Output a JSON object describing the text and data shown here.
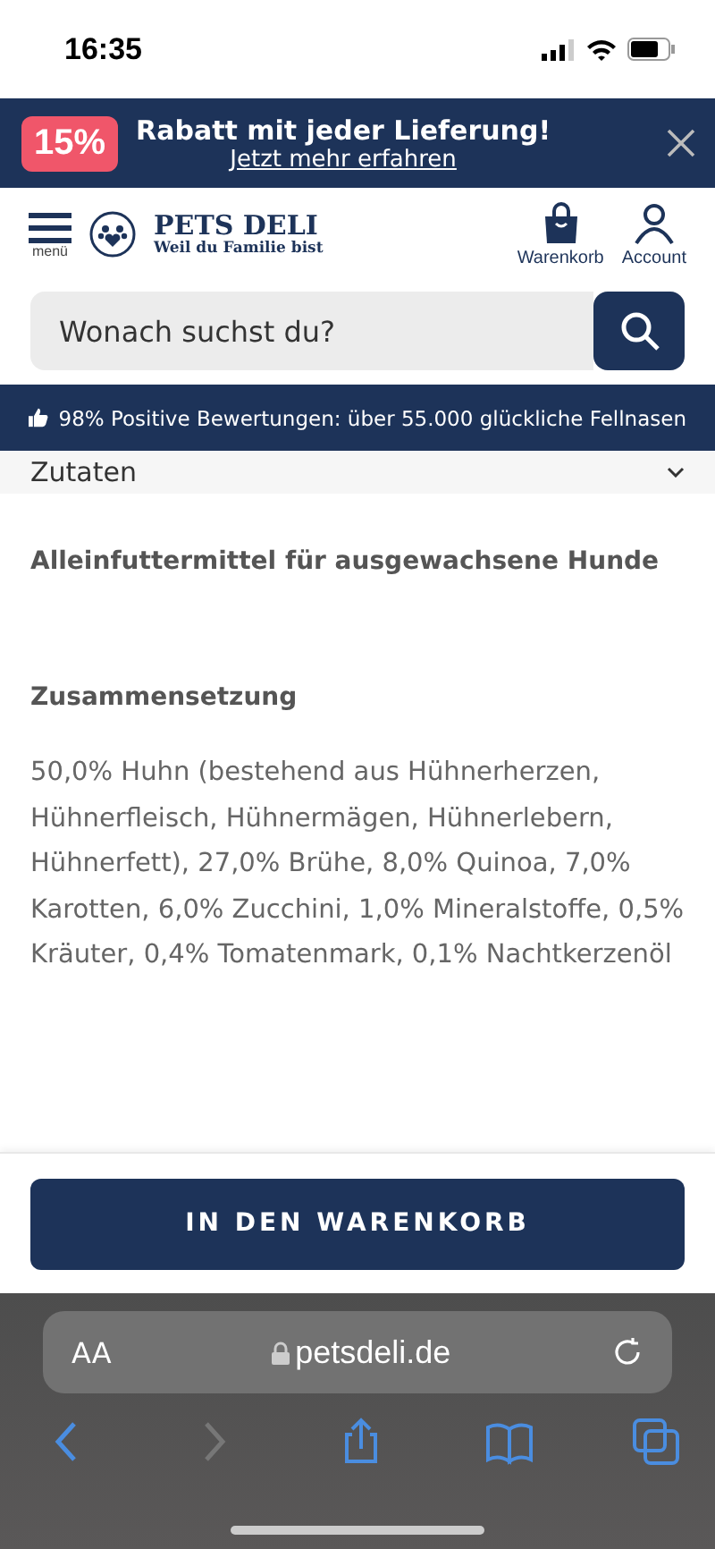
{
  "status_bar": {
    "time": "16:35"
  },
  "promo": {
    "badge": "15%",
    "title": "Rabatt mit jeder Lieferung!",
    "link": "Jetzt mehr erfahren"
  },
  "header": {
    "menu_label": "menü",
    "brand": "PETS DELI",
    "tagline": "Weil du Familie bist",
    "actions": [
      {
        "kind": "cart",
        "label": "Warenkorb"
      },
      {
        "kind": "account",
        "label": "Account"
      }
    ]
  },
  "search": {
    "placeholder": "Wonach suchst du?"
  },
  "rating_bar": {
    "text": "98% Positive Bewertungen: über 55.000 glückliche Fellnasen"
  },
  "accordion": {
    "title": "Zutaten",
    "expanded": true
  },
  "content": [
    {
      "kind": "heading",
      "text": "Alleinfuttermittel für ausgewachsene Hunde"
    },
    {
      "kind": "heading",
      "text": "Zusammensetzung"
    },
    {
      "kind": "paragraph",
      "text": "50,0% Huhn (bestehend aus Hühnerherzen, Hühnerfleisch, Hühnermägen, Hühnerlebern, Hühnerfett), 27,0% Brühe, 8,0% Quinoa, 7,0% Karotten, 6,0% Zucchini, 1,0% Mineralstoffe, 0,5% Kräuter, 0,4% Tomatenmark, 0,1% Nachtkerzenöl"
    }
  ],
  "cart_button": "IN DEN WARENKORB",
  "browser": {
    "text_size": "AA",
    "url": "petsdeli.de",
    "nav": [
      {
        "kind": "back",
        "disabled": false
      },
      {
        "kind": "forward",
        "disabled": true
      },
      {
        "kind": "share",
        "disabled": false
      },
      {
        "kind": "bookmarks",
        "disabled": false
      },
      {
        "kind": "tabs",
        "disabled": false
      }
    ]
  }
}
